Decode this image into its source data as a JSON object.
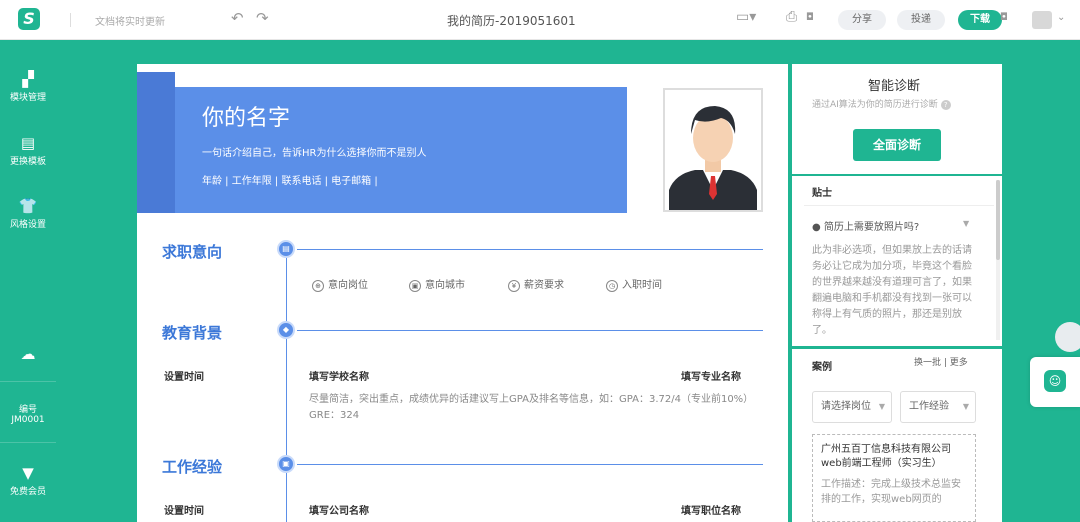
{
  "topbar": {
    "logo": "S",
    "autosave": "文档将实时更新",
    "undo_icon": "undo-icon",
    "redo_icon": "redo-icon",
    "title": "我的简历-2019051601",
    "share": "分享",
    "submit": "投递",
    "download": "下载"
  },
  "sidebar": {
    "items": [
      {
        "label": "模块管理",
        "icon": "▞"
      },
      {
        "label": "更换模板",
        "icon": "▤"
      },
      {
        "label": "风格设置",
        "icon": "👕"
      }
    ],
    "cloud_icon": "☁",
    "code_label": "编号",
    "code_value": "JM0001",
    "vip_label": "免费会员",
    "vip_icon": "▼"
  },
  "resume": {
    "name": "你的名字",
    "intro": "一句话介绍自己，告诉HR为什么选择你而不是别人",
    "contacts": "年龄 | 工作年限 | 联系电话 | 电子邮箱 |",
    "sections": {
      "intent": "求职意向",
      "education": "教育背景",
      "work": "工作经验"
    },
    "intent_items": [
      "意向岗位",
      "意向城市",
      "薪资要求",
      "入职时间"
    ],
    "intent_icons": [
      "⊕",
      "▣",
      "¥",
      "◷"
    ],
    "edu": {
      "time": "设置时间",
      "school": "填写学校名称",
      "major": "填写专业名称",
      "desc": "尽量简洁，突出重点，成绩优异的话建议写上GPA及排名等信息，如：GPA：3.72/4（专业前10%） GRE：324"
    },
    "work": {
      "time": "设置时间",
      "company": "填写公司名称",
      "position": "填写职位名称"
    }
  },
  "right_panel": {
    "diag_title": "智能诊断",
    "diag_sub": "通过AI算法为你的简历进行诊断",
    "diag_btn": "全面诊断",
    "tips_title": "贴士",
    "tips_q": "● 简历上需要放照片吗?",
    "tips_body": "此为非必选项，但如果放上去的话请务必让它成为加分项，毕竟这个看脸的世界越来越没有道理可言了，如果翻遍电脑和手机都没有找到一张可以称得上有气质的照片，那还是别放了。",
    "cases_title": "案例",
    "cases_links": "换一批 | 更多",
    "select_pos": "请选择岗位",
    "select_exp": "工作经验",
    "case_company": "广州五百丁信息科技有限公司 web前端工程师（实习生）",
    "case_desc": "工作描述：完成上级技术总监安排的工作，实现web网页的"
  },
  "colors": {
    "brand": "#1fb592",
    "banner": "#5b8fe8",
    "section_title": "#3c78d8"
  }
}
